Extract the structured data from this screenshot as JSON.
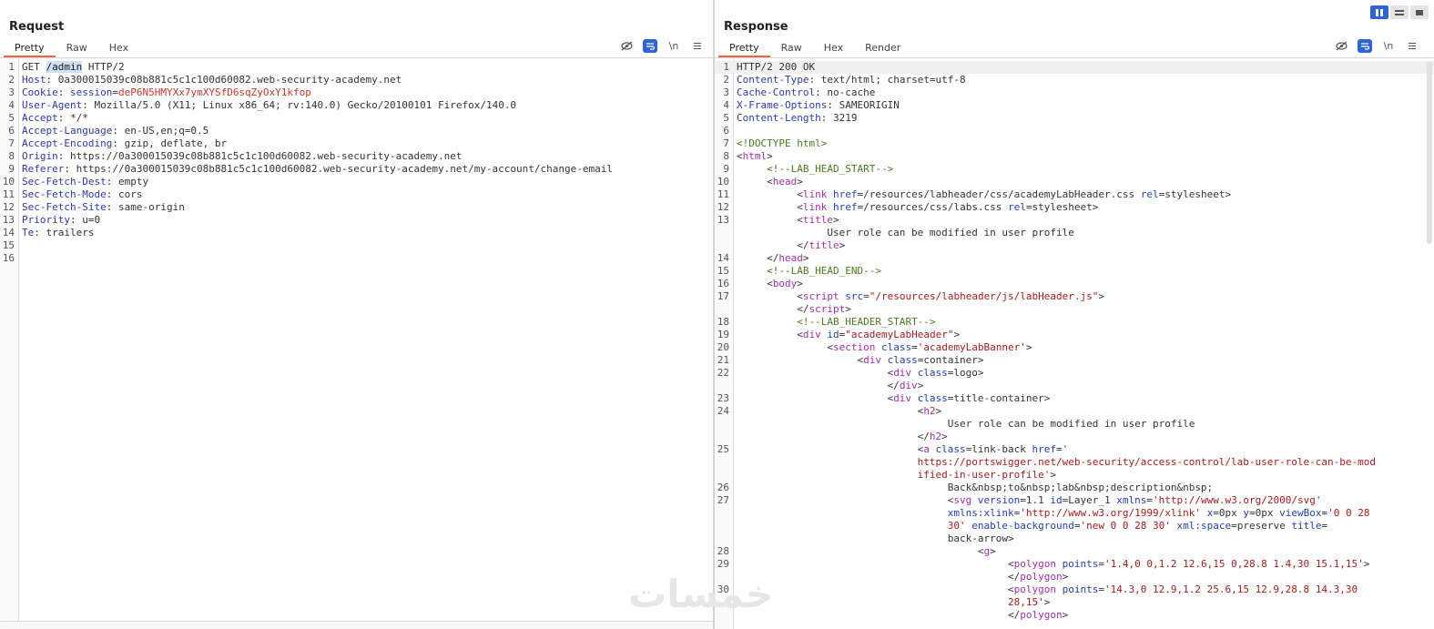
{
  "layout_toggles": [
    "side-by-side",
    "stacked",
    "tabs"
  ],
  "request": {
    "title": "Request",
    "tabs": [
      "Pretty",
      "Raw",
      "Hex"
    ],
    "active_tab": "Pretty",
    "newline_label": "\\n",
    "lines": [
      {
        "n": "1",
        "parts": [
          [
            "v",
            "GET "
          ],
          [
            "sel",
            "/admin"
          ],
          [
            "v",
            " HTTP/2"
          ]
        ]
      },
      {
        "n": "2",
        "parts": [
          [
            "k",
            "Host"
          ],
          [
            "v",
            ": 0a300015039c08b881c5c1c100d60082.web-security-academy.net"
          ]
        ]
      },
      {
        "n": "3",
        "parts": [
          [
            "k",
            "Cookie"
          ],
          [
            "v",
            ": "
          ],
          [
            "k",
            "session"
          ],
          [
            "v",
            "="
          ],
          [
            "r",
            "deP6N5HMYXx7ymXYSfD6sqZyOxY1kfop"
          ]
        ]
      },
      {
        "n": "4",
        "parts": [
          [
            "k",
            "User-Agent"
          ],
          [
            "v",
            ": Mozilla/5.0 (X11; Linux x86_64; rv:140.0) Gecko/20100101 Firefox/140.0"
          ]
        ]
      },
      {
        "n": "5",
        "parts": [
          [
            "k",
            "Accept"
          ],
          [
            "v",
            ": */*"
          ]
        ]
      },
      {
        "n": "6",
        "parts": [
          [
            "k",
            "Accept-Language"
          ],
          [
            "v",
            ": en-US,en;q=0.5"
          ]
        ]
      },
      {
        "n": "7",
        "parts": [
          [
            "k",
            "Accept-Encoding"
          ],
          [
            "v",
            ": gzip, deflate, br"
          ]
        ]
      },
      {
        "n": "8",
        "parts": [
          [
            "k",
            "Origin"
          ],
          [
            "v",
            ": https://0a300015039c08b881c5c1c100d60082.web-security-academy.net"
          ]
        ]
      },
      {
        "n": "9",
        "parts": [
          [
            "k",
            "Referer"
          ],
          [
            "v",
            ": https://0a300015039c08b881c5c1c100d60082.web-security-academy.net/my-account/change-email"
          ]
        ]
      },
      {
        "n": "10",
        "parts": [
          [
            "k",
            "Sec-Fetch-Dest"
          ],
          [
            "v",
            ": empty"
          ]
        ]
      },
      {
        "n": "11",
        "parts": [
          [
            "k",
            "Sec-Fetch-Mode"
          ],
          [
            "v",
            ": cors"
          ]
        ]
      },
      {
        "n": "12",
        "parts": [
          [
            "k",
            "Sec-Fetch-Site"
          ],
          [
            "v",
            ": same-origin"
          ]
        ]
      },
      {
        "n": "13",
        "parts": [
          [
            "k",
            "Priority"
          ],
          [
            "v",
            ": u=0"
          ]
        ]
      },
      {
        "n": "14",
        "parts": [
          [
            "k",
            "Te"
          ],
          [
            "v",
            ": trailers"
          ]
        ]
      },
      {
        "n": "15",
        "parts": []
      },
      {
        "n": "16",
        "parts": []
      }
    ]
  },
  "response": {
    "title": "Response",
    "tabs": [
      "Pretty",
      "Raw",
      "Hex",
      "Render"
    ],
    "active_tab": "Pretty",
    "newline_label": "\\n",
    "lines": [
      {
        "n": "1",
        "hl": true,
        "parts": [
          [
            "v",
            "HTTP/2 200 OK"
          ]
        ]
      },
      {
        "n": "2",
        "parts": [
          [
            "k",
            "Content-Type"
          ],
          [
            "v",
            ": text/html; charset=utf-8"
          ]
        ]
      },
      {
        "n": "3",
        "parts": [
          [
            "k",
            "Cache-Control"
          ],
          [
            "v",
            ": no-cache"
          ]
        ]
      },
      {
        "n": "4",
        "parts": [
          [
            "k",
            "X-Frame-Options"
          ],
          [
            "v",
            ": SAMEORIGIN"
          ]
        ]
      },
      {
        "n": "5",
        "parts": [
          [
            "k",
            "Content-Length"
          ],
          [
            "v",
            ": 3219"
          ]
        ]
      },
      {
        "n": "6",
        "parts": []
      },
      {
        "n": "7",
        "parts": [
          [
            "g",
            "<!DOCTYPE html>"
          ]
        ]
      },
      {
        "n": "8",
        "parts": [
          [
            "v",
            "<"
          ],
          [
            "t",
            "html"
          ],
          [
            "v",
            ">"
          ]
        ]
      },
      {
        "n": "9",
        "parts": [
          [
            "v",
            "     "
          ],
          [
            "g",
            "<!--LAB_HEAD_START-->"
          ]
        ]
      },
      {
        "n": "10",
        "parts": [
          [
            "v",
            "     <"
          ],
          [
            "t",
            "head"
          ],
          [
            "v",
            ">"
          ]
        ]
      },
      {
        "n": "11",
        "parts": [
          [
            "v",
            "          <"
          ],
          [
            "t",
            "link"
          ],
          [
            "v",
            " "
          ],
          [
            "a",
            "href"
          ],
          [
            "v",
            "=/resources/labheader/css/academyLabHeader.css "
          ],
          [
            "a",
            "rel"
          ],
          [
            "v",
            "=stylesheet>"
          ]
        ]
      },
      {
        "n": "12",
        "parts": [
          [
            "v",
            "          <"
          ],
          [
            "t",
            "link"
          ],
          [
            "v",
            " "
          ],
          [
            "a",
            "href"
          ],
          [
            "v",
            "=/resources/css/labs.css "
          ],
          [
            "a",
            "rel"
          ],
          [
            "v",
            "=stylesheet>"
          ]
        ]
      },
      {
        "n": "13",
        "parts": [
          [
            "v",
            "          <"
          ],
          [
            "t",
            "title"
          ],
          [
            "v",
            ">"
          ]
        ]
      },
      {
        "n": "",
        "parts": [
          [
            "v",
            "               User role can be modified in user profile"
          ]
        ]
      },
      {
        "n": "",
        "parts": [
          [
            "v",
            "          </"
          ],
          [
            "t",
            "title"
          ],
          [
            "v",
            ">"
          ]
        ]
      },
      {
        "n": "14",
        "parts": [
          [
            "v",
            "     </"
          ],
          [
            "t",
            "head"
          ],
          [
            "v",
            ">"
          ]
        ]
      },
      {
        "n": "15",
        "parts": [
          [
            "v",
            "     "
          ],
          [
            "g",
            "<!--LAB_HEAD_END-->"
          ]
        ]
      },
      {
        "n": "16",
        "parts": [
          [
            "v",
            "     <"
          ],
          [
            "t",
            "body"
          ],
          [
            "v",
            ">"
          ]
        ]
      },
      {
        "n": "17",
        "parts": [
          [
            "v",
            "          <"
          ],
          [
            "t",
            "script"
          ],
          [
            "v",
            " "
          ],
          [
            "a",
            "src"
          ],
          [
            "v",
            "="
          ],
          [
            "s",
            "\"/resources/labheader/js/labHeader.js\""
          ],
          [
            "v",
            ">"
          ]
        ]
      },
      {
        "n": "",
        "parts": [
          [
            "v",
            "          </"
          ],
          [
            "t",
            "script"
          ],
          [
            "v",
            ">"
          ]
        ]
      },
      {
        "n": "18",
        "parts": [
          [
            "v",
            "          "
          ],
          [
            "g",
            "<!--LAB_HEADER_START-->"
          ]
        ]
      },
      {
        "n": "19",
        "parts": [
          [
            "v",
            "          <"
          ],
          [
            "t",
            "div"
          ],
          [
            "v",
            " "
          ],
          [
            "a",
            "id"
          ],
          [
            "v",
            "="
          ],
          [
            "s",
            "\"academyLabHeader\""
          ],
          [
            "v",
            ">"
          ]
        ]
      },
      {
        "n": "20",
        "parts": [
          [
            "v",
            "               <"
          ],
          [
            "t",
            "section"
          ],
          [
            "v",
            " "
          ],
          [
            "a",
            "class"
          ],
          [
            "v",
            "="
          ],
          [
            "s",
            "'academyLabBanner'"
          ],
          [
            "v",
            ">"
          ]
        ]
      },
      {
        "n": "21",
        "parts": [
          [
            "v",
            "                    <"
          ],
          [
            "t",
            "div"
          ],
          [
            "v",
            " "
          ],
          [
            "a",
            "class"
          ],
          [
            "v",
            "=container>"
          ]
        ]
      },
      {
        "n": "22",
        "parts": [
          [
            "v",
            "                         <"
          ],
          [
            "t",
            "div"
          ],
          [
            "v",
            " "
          ],
          [
            "a",
            "class"
          ],
          [
            "v",
            "=logo>"
          ]
        ]
      },
      {
        "n": "",
        "parts": [
          [
            "v",
            "                         </"
          ],
          [
            "t",
            "div"
          ],
          [
            "v",
            ">"
          ]
        ]
      },
      {
        "n": "23",
        "parts": [
          [
            "v",
            "                         <"
          ],
          [
            "t",
            "div"
          ],
          [
            "v",
            " "
          ],
          [
            "a",
            "class"
          ],
          [
            "v",
            "=title-container>"
          ]
        ]
      },
      {
        "n": "24",
        "parts": [
          [
            "v",
            "                              <"
          ],
          [
            "t",
            "h2"
          ],
          [
            "v",
            ">"
          ]
        ]
      },
      {
        "n": "",
        "parts": [
          [
            "v",
            "                                   User role can be modified in user profile"
          ]
        ]
      },
      {
        "n": "",
        "parts": [
          [
            "v",
            "                              </"
          ],
          [
            "t",
            "h2"
          ],
          [
            "v",
            ">"
          ]
        ]
      },
      {
        "n": "25",
        "parts": [
          [
            "v",
            "                              <"
          ],
          [
            "t",
            "a"
          ],
          [
            "v",
            " "
          ],
          [
            "a",
            "class"
          ],
          [
            "v",
            "=link-back "
          ],
          [
            "a",
            "href"
          ],
          [
            "v",
            "="
          ],
          [
            "s",
            "'"
          ]
        ]
      },
      {
        "n": "",
        "parts": [
          [
            "s",
            "                              https://portswigger.net/web-security/access-control/lab-user-role-can-be-mod"
          ]
        ]
      },
      {
        "n": "",
        "parts": [
          [
            "s",
            "                              ified-in-user-profile'"
          ],
          [
            "v",
            ">"
          ]
        ]
      },
      {
        "n": "26",
        "parts": [
          [
            "v",
            "                                   Back&nbsp;to&nbsp;lab&nbsp;description&nbsp;"
          ]
        ]
      },
      {
        "n": "27",
        "parts": [
          [
            "v",
            "                                   <"
          ],
          [
            "t",
            "svg"
          ],
          [
            "v",
            " "
          ],
          [
            "a",
            "version"
          ],
          [
            "v",
            "=1.1 "
          ],
          [
            "a",
            "id"
          ],
          [
            "v",
            "=Layer_1 "
          ],
          [
            "a",
            "xmlns"
          ],
          [
            "v",
            "="
          ],
          [
            "s",
            "'http://www.w3.org/2000/svg'"
          ]
        ]
      },
      {
        "n": "",
        "parts": [
          [
            "v",
            "                                   "
          ],
          [
            "a",
            "xmlns:xlink"
          ],
          [
            "v",
            "="
          ],
          [
            "s",
            "'http://www.w3.org/1999/xlink'"
          ],
          [
            "v",
            " "
          ],
          [
            "a",
            "x"
          ],
          [
            "v",
            "=0px "
          ],
          [
            "a",
            "y"
          ],
          [
            "v",
            "=0px "
          ],
          [
            "a",
            "viewBox"
          ],
          [
            "v",
            "="
          ],
          [
            "s",
            "'0 0 28"
          ]
        ]
      },
      {
        "n": "",
        "parts": [
          [
            "s",
            "                                   30'"
          ],
          [
            "v",
            " "
          ],
          [
            "a",
            "enable-background"
          ],
          [
            "v",
            "="
          ],
          [
            "s",
            "'new 0 0 28 30'"
          ],
          [
            "v",
            " "
          ],
          [
            "a",
            "xml:space"
          ],
          [
            "v",
            "=preserve "
          ],
          [
            "a",
            "title"
          ],
          [
            "v",
            "="
          ]
        ]
      },
      {
        "n": "",
        "parts": [
          [
            "v",
            "                                   back-arrow>"
          ]
        ]
      },
      {
        "n": "28",
        "parts": [
          [
            "v",
            "                                        <"
          ],
          [
            "t",
            "g"
          ],
          [
            "v",
            ">"
          ]
        ]
      },
      {
        "n": "29",
        "parts": [
          [
            "v",
            "                                             <"
          ],
          [
            "t",
            "polygon"
          ],
          [
            "v",
            " "
          ],
          [
            "a",
            "points"
          ],
          [
            "v",
            "="
          ],
          [
            "s",
            "'1.4,0 0,1.2 12.6,15 0,28.8 1.4,30 15.1,15'"
          ],
          [
            "v",
            ">"
          ]
        ]
      },
      {
        "n": "",
        "parts": [
          [
            "v",
            "                                             </"
          ],
          [
            "t",
            "polygon"
          ],
          [
            "v",
            ">"
          ]
        ]
      },
      {
        "n": "30",
        "parts": [
          [
            "v",
            "                                             <"
          ],
          [
            "t",
            "polygon"
          ],
          [
            "v",
            " "
          ],
          [
            "a",
            "points"
          ],
          [
            "v",
            "="
          ],
          [
            "s",
            "'14.3,0 12.9,1.2 25.6,15 12.9,28.8 14.3,30"
          ]
        ]
      },
      {
        "n": "",
        "parts": [
          [
            "s",
            "                                             28,15'"
          ],
          [
            "v",
            ">"
          ]
        ]
      },
      {
        "n": "",
        "parts": [
          [
            "v",
            "                                             </"
          ],
          [
            "t",
            "polygon"
          ],
          [
            "v",
            ">"
          ]
        ]
      }
    ]
  }
}
